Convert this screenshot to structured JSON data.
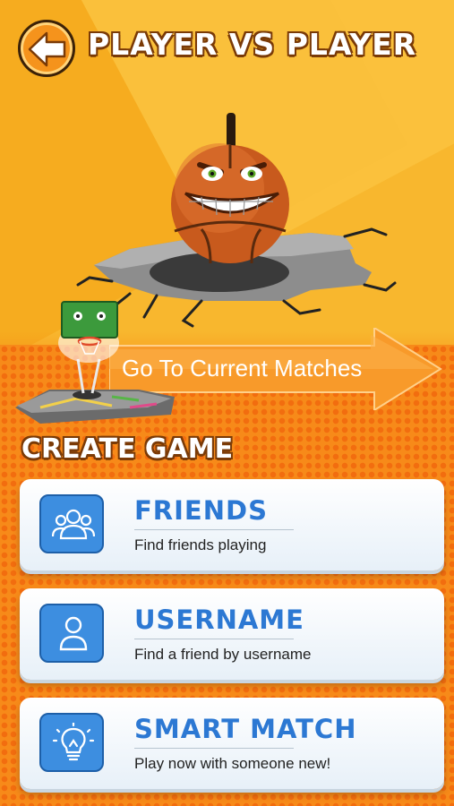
{
  "header": {
    "title": "PLAYER VS PLAYER",
    "back_icon": "back-arrow-icon"
  },
  "current_matches": {
    "label": "Go To Current Matches"
  },
  "create_game": {
    "heading": "CREATE GAME",
    "options": [
      {
        "title": "FRIENDS",
        "subtitle": "Find friends playing",
        "icon": "friends-group-icon"
      },
      {
        "title": "USERNAME",
        "subtitle": "Find a friend by username",
        "icon": "user-icon"
      },
      {
        "title": "SMART MATCH",
        "subtitle": "Play now with someone new!",
        "icon": "lightbulb-icon"
      }
    ]
  },
  "colors": {
    "background": "#f8b72e",
    "accent_orange": "#f78a19",
    "card_blue": "#2c78d3",
    "icon_blue": "#3d8ee0"
  }
}
